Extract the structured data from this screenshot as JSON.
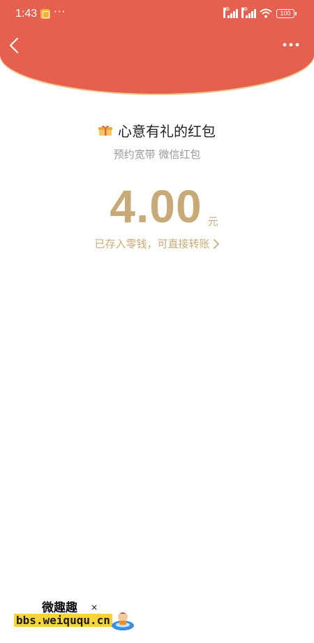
{
  "status_bar": {
    "time": "1:43",
    "more": "···",
    "signal_1_label": "HD",
    "signal_2_label": "HD",
    "battery": "100"
  },
  "nav": {
    "back_icon": "chevron-left-icon",
    "more_icon": "more-dots-icon"
  },
  "red_packet": {
    "title": "心意有礼的红包",
    "subtitle": "预约宽带 微信红包",
    "amount": "4.00",
    "unit": "元",
    "note": "已存入零钱，可直接转账"
  },
  "watermark": {
    "title": "微趣趣",
    "url": "bbs.weiququ.cn"
  },
  "colors": {
    "header_red": "#e5604f",
    "gold": "#c8aa78",
    "header_edge": "#f0c78a"
  }
}
